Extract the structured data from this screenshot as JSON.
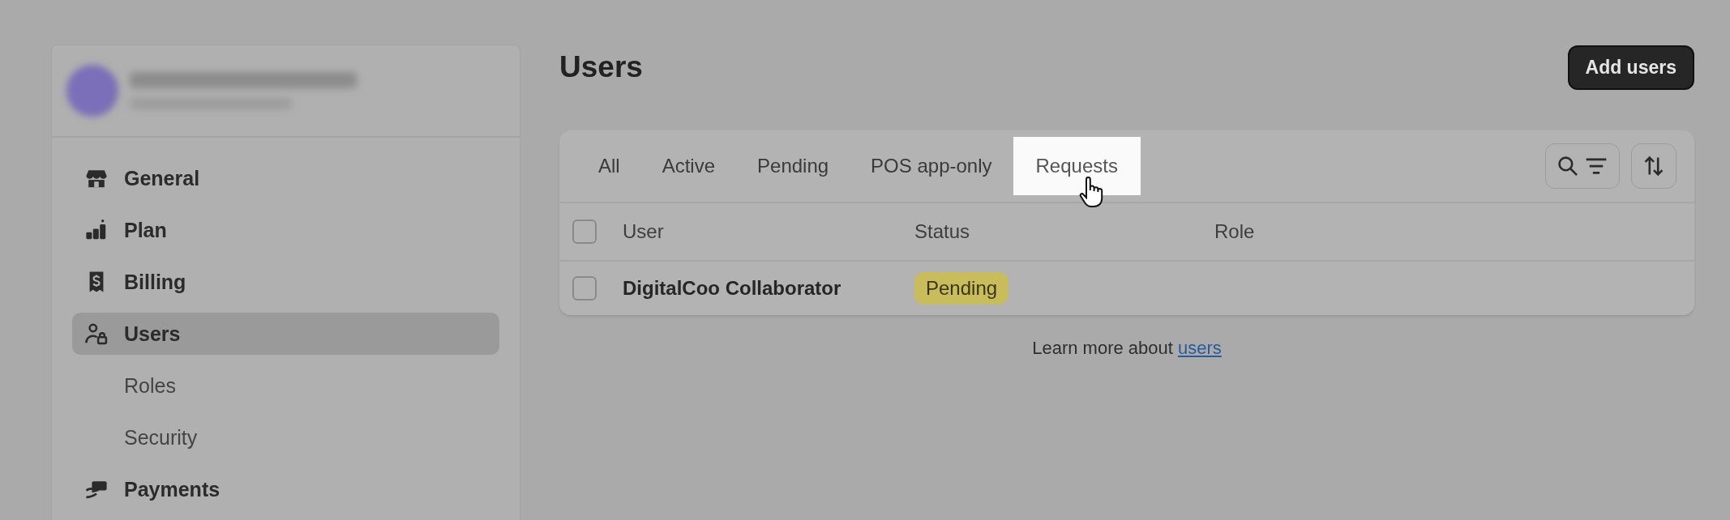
{
  "sidebar": {
    "items": [
      {
        "label": "General",
        "selected": false
      },
      {
        "label": "Plan",
        "selected": false
      },
      {
        "label": "Billing",
        "selected": false
      },
      {
        "label": "Users",
        "selected": true,
        "children": [
          {
            "label": "Roles",
            "selected": false
          },
          {
            "label": "Security",
            "selected": false
          }
        ]
      },
      {
        "label": "Payments",
        "selected": false
      }
    ]
  },
  "page": {
    "title": "Users",
    "primary_button": "Add users"
  },
  "tabs": [
    {
      "label": "All",
      "selected": false
    },
    {
      "label": "Active",
      "selected": false
    },
    {
      "label": "Pending",
      "selected": false
    },
    {
      "label": "POS app-only",
      "selected": false
    },
    {
      "label": "Requests",
      "selected": true
    }
  ],
  "table": {
    "header_checked": false,
    "columns": [
      "User",
      "Status",
      "Role"
    ],
    "rows": [
      {
        "user": "DigitalCoo Collaborator",
        "status": "Pending",
        "checked": false
      }
    ]
  },
  "footer": {
    "text": "Learn more about ",
    "link": "users"
  }
}
